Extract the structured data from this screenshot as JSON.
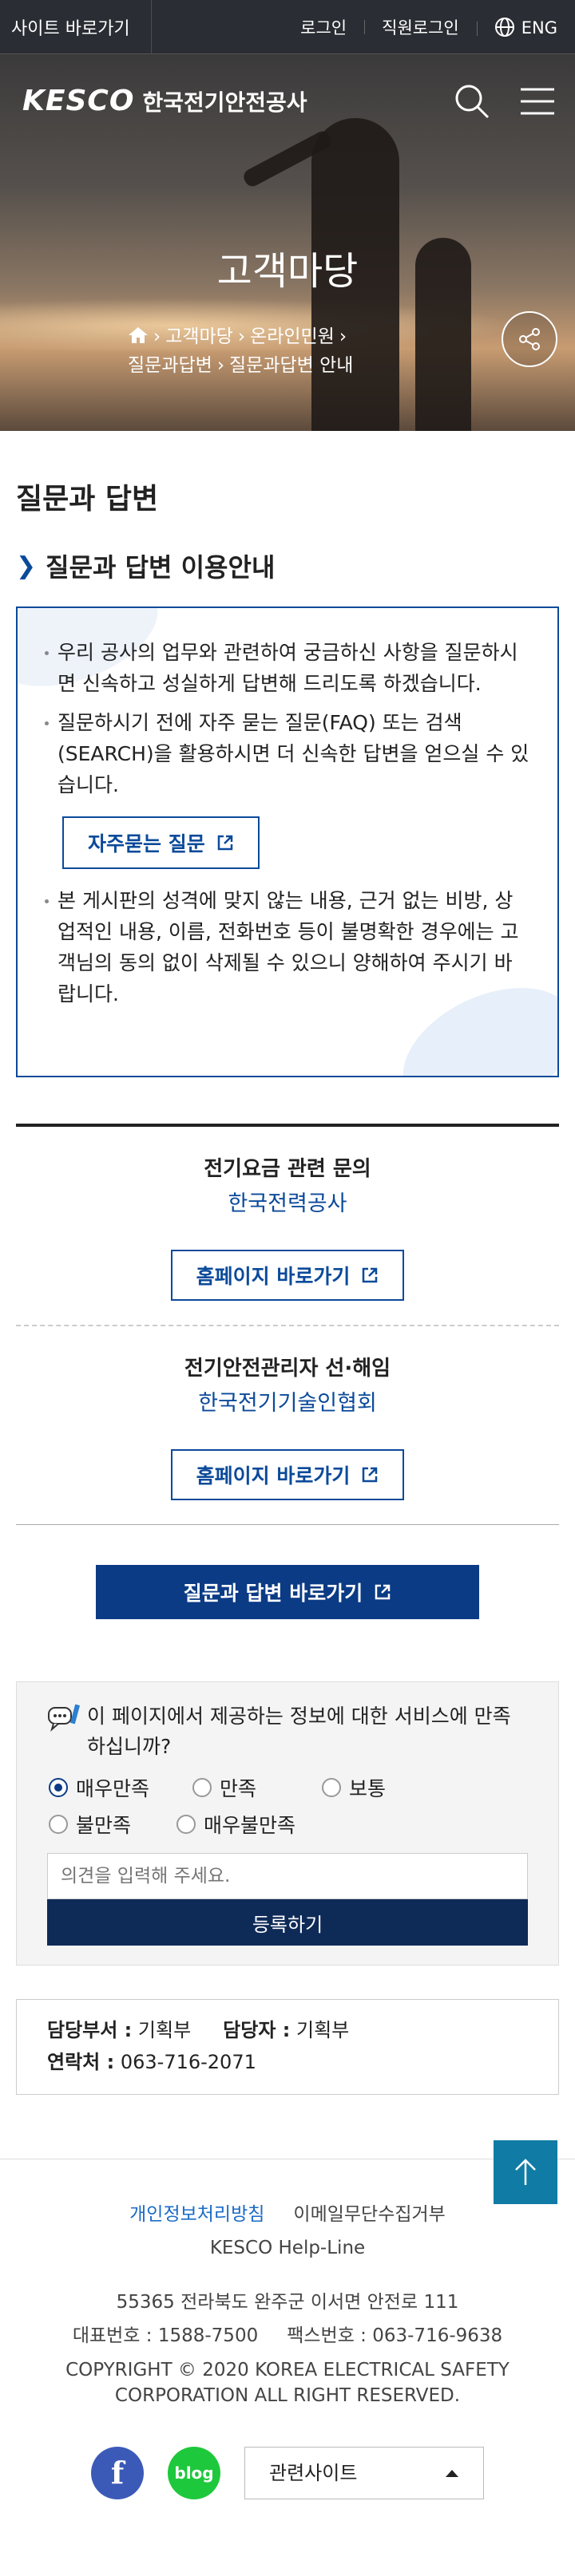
{
  "topbar": {
    "site_go": "사이트 바로가기",
    "login": "로그인",
    "staff_login": "직원로그인",
    "lang": "ENG"
  },
  "hero": {
    "logo_en": "KESCO",
    "logo_ko": "한국전기안전공사",
    "title": "고객마당",
    "breadcrumb": [
      "고객마당",
      "온라인민원",
      "질문과답변",
      "질문과답변 안내"
    ]
  },
  "page_title": "질문과 답변",
  "guide": {
    "heading": "질문과 답변 이용안내",
    "items": [
      "우리 공사의 업무와 관련하여 궁금하신 사항을 질문하시면 신속하고 성실하게 답변해 드리도록 하겠습니다.",
      "질문하시기 전에 자주 묻는 질문(FAQ) 또는 검색(SEARCH)을 활용하시면 더 신속한 답변을 얻으실 수 있습니다.",
      "본 게시판의 성격에 맞지 않는 내용, 근거 없는 비방, 상업적인 내용, 이름, 전화번호 등이 불명확한 경우에는 고객님의 동의 없이 삭제될 수 있으니 양해하여 주시기 바랍니다."
    ],
    "faq_button": "자주묻는 질문"
  },
  "related": [
    {
      "question": "전기요금 관련 문의",
      "org": "한국전력공사",
      "button": "홈페이지 바로가기"
    },
    {
      "question": "전기안전관리자 선·해임",
      "org": "한국전기기술인협회",
      "button": "홈페이지 바로가기"
    }
  ],
  "main_button": "질문과 답변 바로가기",
  "survey": {
    "question": "이 페이지에서 제공하는 정보에 대한 서비스에 만족하십니까?",
    "options": [
      "매우만족",
      "만족",
      "보통",
      "불만족",
      "매우불만족"
    ],
    "selected": "매우만족",
    "placeholder": "의견을 입력해 주세요.",
    "submit": "등록하기"
  },
  "contact": {
    "dept_label": "담당부서 :",
    "dept": "기획부",
    "person_label": "담당자 :",
    "person": "기획부",
    "phone_label": "연락처 :",
    "phone": "063-716-2071"
  },
  "footer": {
    "privacy": "개인정보처리방침",
    "email_policy": "이메일무단수집거부",
    "helpline": "KESCO Help-Line",
    "address": "55365 전라북도 완주군 이서면 안전로 111",
    "tel_label": "대표번호 :",
    "tel": "1588-7500",
    "fax_label": "팩스번호 :",
    "fax": "063-716-9638",
    "copyright": "COPYRIGHT © 2020 KOREA ELECTRICAL SAFETY CORPORATION ALL RIGHT RESERVED.",
    "blog": "blog",
    "related_sites": "관련사이트"
  },
  "colors": {
    "primary": "#0b3b85",
    "topbar": "#2a2d33",
    "accent_top": "#107ca5"
  }
}
